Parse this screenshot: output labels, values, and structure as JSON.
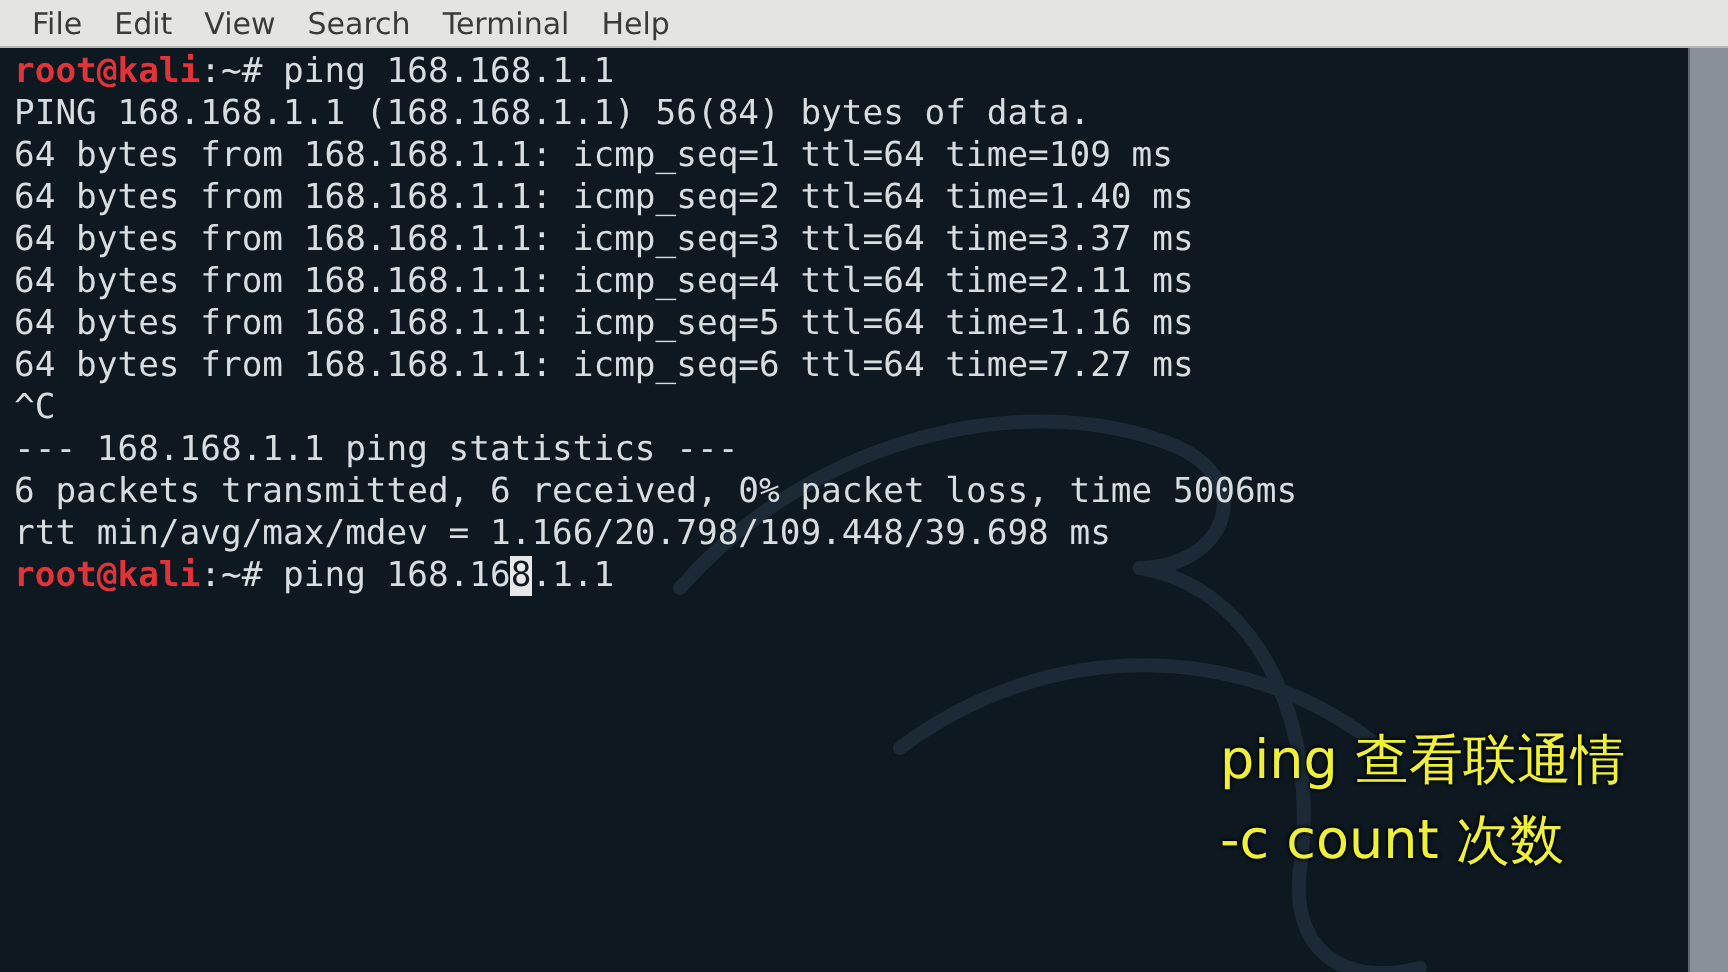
{
  "menu_bar": {
    "items": [
      "File",
      "Edit",
      "View",
      "Search",
      "Terminal",
      "Help"
    ]
  },
  "terminal": {
    "lines": [
      {
        "kind": "prompt",
        "user_host": "root@kali",
        "path": ":~#",
        "command": "ping 168.168.1.1"
      },
      {
        "kind": "output",
        "text": "PING 168.168.1.1 (168.168.1.1) 56(84) bytes of data."
      },
      {
        "kind": "output",
        "text": "64 bytes from 168.168.1.1: icmp_seq=1 ttl=64 time=109 ms"
      },
      {
        "kind": "output",
        "text": "64 bytes from 168.168.1.1: icmp_seq=2 ttl=64 time=1.40 ms"
      },
      {
        "kind": "output",
        "text": "64 bytes from 168.168.1.1: icmp_seq=3 ttl=64 time=3.37 ms"
      },
      {
        "kind": "output",
        "text": "64 bytes from 168.168.1.1: icmp_seq=4 ttl=64 time=2.11 ms"
      },
      {
        "kind": "output",
        "text": "64 bytes from 168.168.1.1: icmp_seq=5 ttl=64 time=1.16 ms"
      },
      {
        "kind": "output",
        "text": "64 bytes from 168.168.1.1: icmp_seq=6 ttl=64 time=7.27 ms"
      },
      {
        "kind": "output",
        "text": "^C"
      },
      {
        "kind": "output",
        "text": "--- 168.168.1.1 ping statistics ---"
      },
      {
        "kind": "output",
        "text": "6 packets transmitted, 6 received, 0% packet loss, time 5006ms"
      },
      {
        "kind": "output",
        "text": "rtt min/avg/max/mdev = 1.166/20.798/109.448/39.698 ms"
      },
      {
        "kind": "prompt",
        "user_host": "root@kali",
        "path": ":~#",
        "command": "ping 168.16",
        "cursor_char": "8",
        "command_after": ".1.1"
      }
    ]
  },
  "caption": {
    "lines": [
      "ping 查看联通情",
      "-c count 次数"
    ]
  }
}
